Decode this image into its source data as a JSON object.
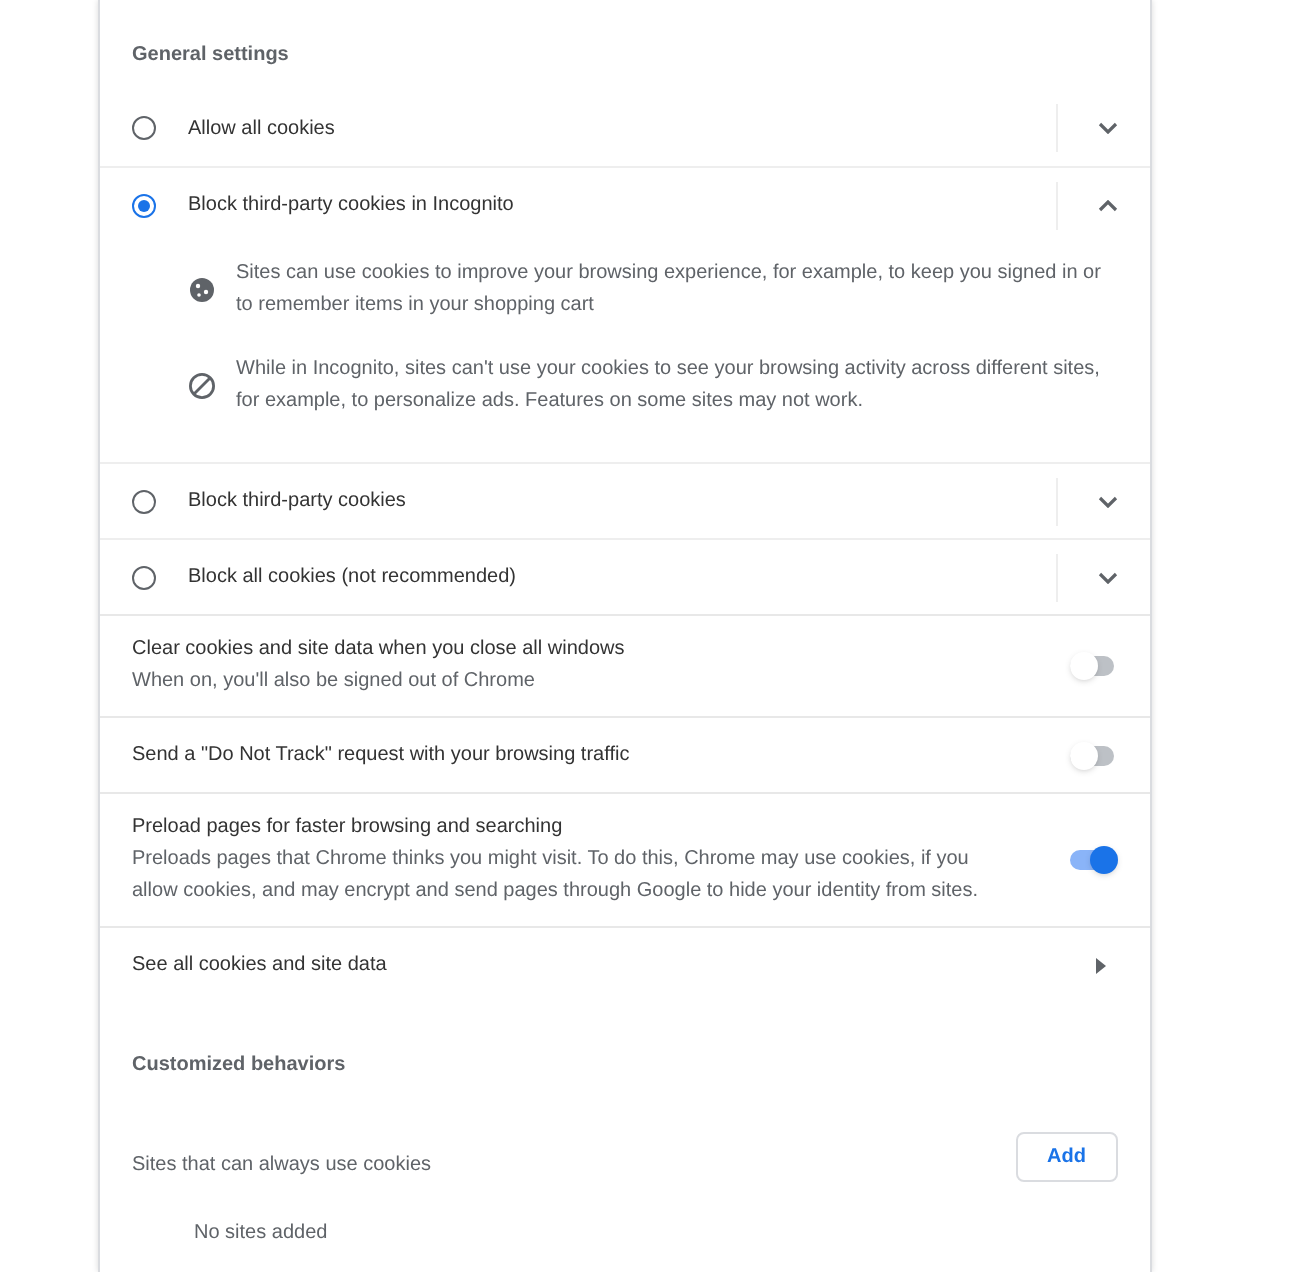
{
  "general_settings": {
    "title": "General settings",
    "cookie_options": [
      {
        "label": "Allow all cookies",
        "selected": false,
        "expanded": false
      },
      {
        "label": "Block third-party cookies in Incognito",
        "selected": true,
        "expanded": true,
        "details": [
          {
            "kind": "cookie",
            "text": "Sites can use cookies to improve your browsing experience, for example, to keep you signed in or to remember items in your shopping cart"
          },
          {
            "kind": "block",
            "text": "While in Incognito, sites can't use your cookies to see your browsing activity across different sites, for example, to personalize ads. Features on some sites may not work."
          }
        ]
      },
      {
        "label": "Block third-party cookies",
        "selected": false,
        "expanded": false
      },
      {
        "label": "Block all cookies (not recommended)",
        "selected": false,
        "expanded": false
      }
    ],
    "toggles": [
      {
        "title": "Clear cookies and site data when you close all windows",
        "description": "When on, you'll also be signed out of Chrome",
        "on": false
      },
      {
        "title": "Send a \"Do Not Track\" request with your browsing traffic",
        "on": false
      },
      {
        "title": "Preload pages for faster browsing and searching",
        "description": "Preloads pages that Chrome thinks you might visit. To do this, Chrome may use cookies, if you allow cookies, and may encrypt and send pages through Google to hide your identity from sites.",
        "on": true
      }
    ],
    "link": {
      "label": "See all cookies and site data"
    }
  },
  "customized_behaviors": {
    "title": "Customized behaviors",
    "lists": [
      {
        "label": "Sites that can always use cookies",
        "button": "Add",
        "empty_text": "No sites added"
      }
    ]
  }
}
